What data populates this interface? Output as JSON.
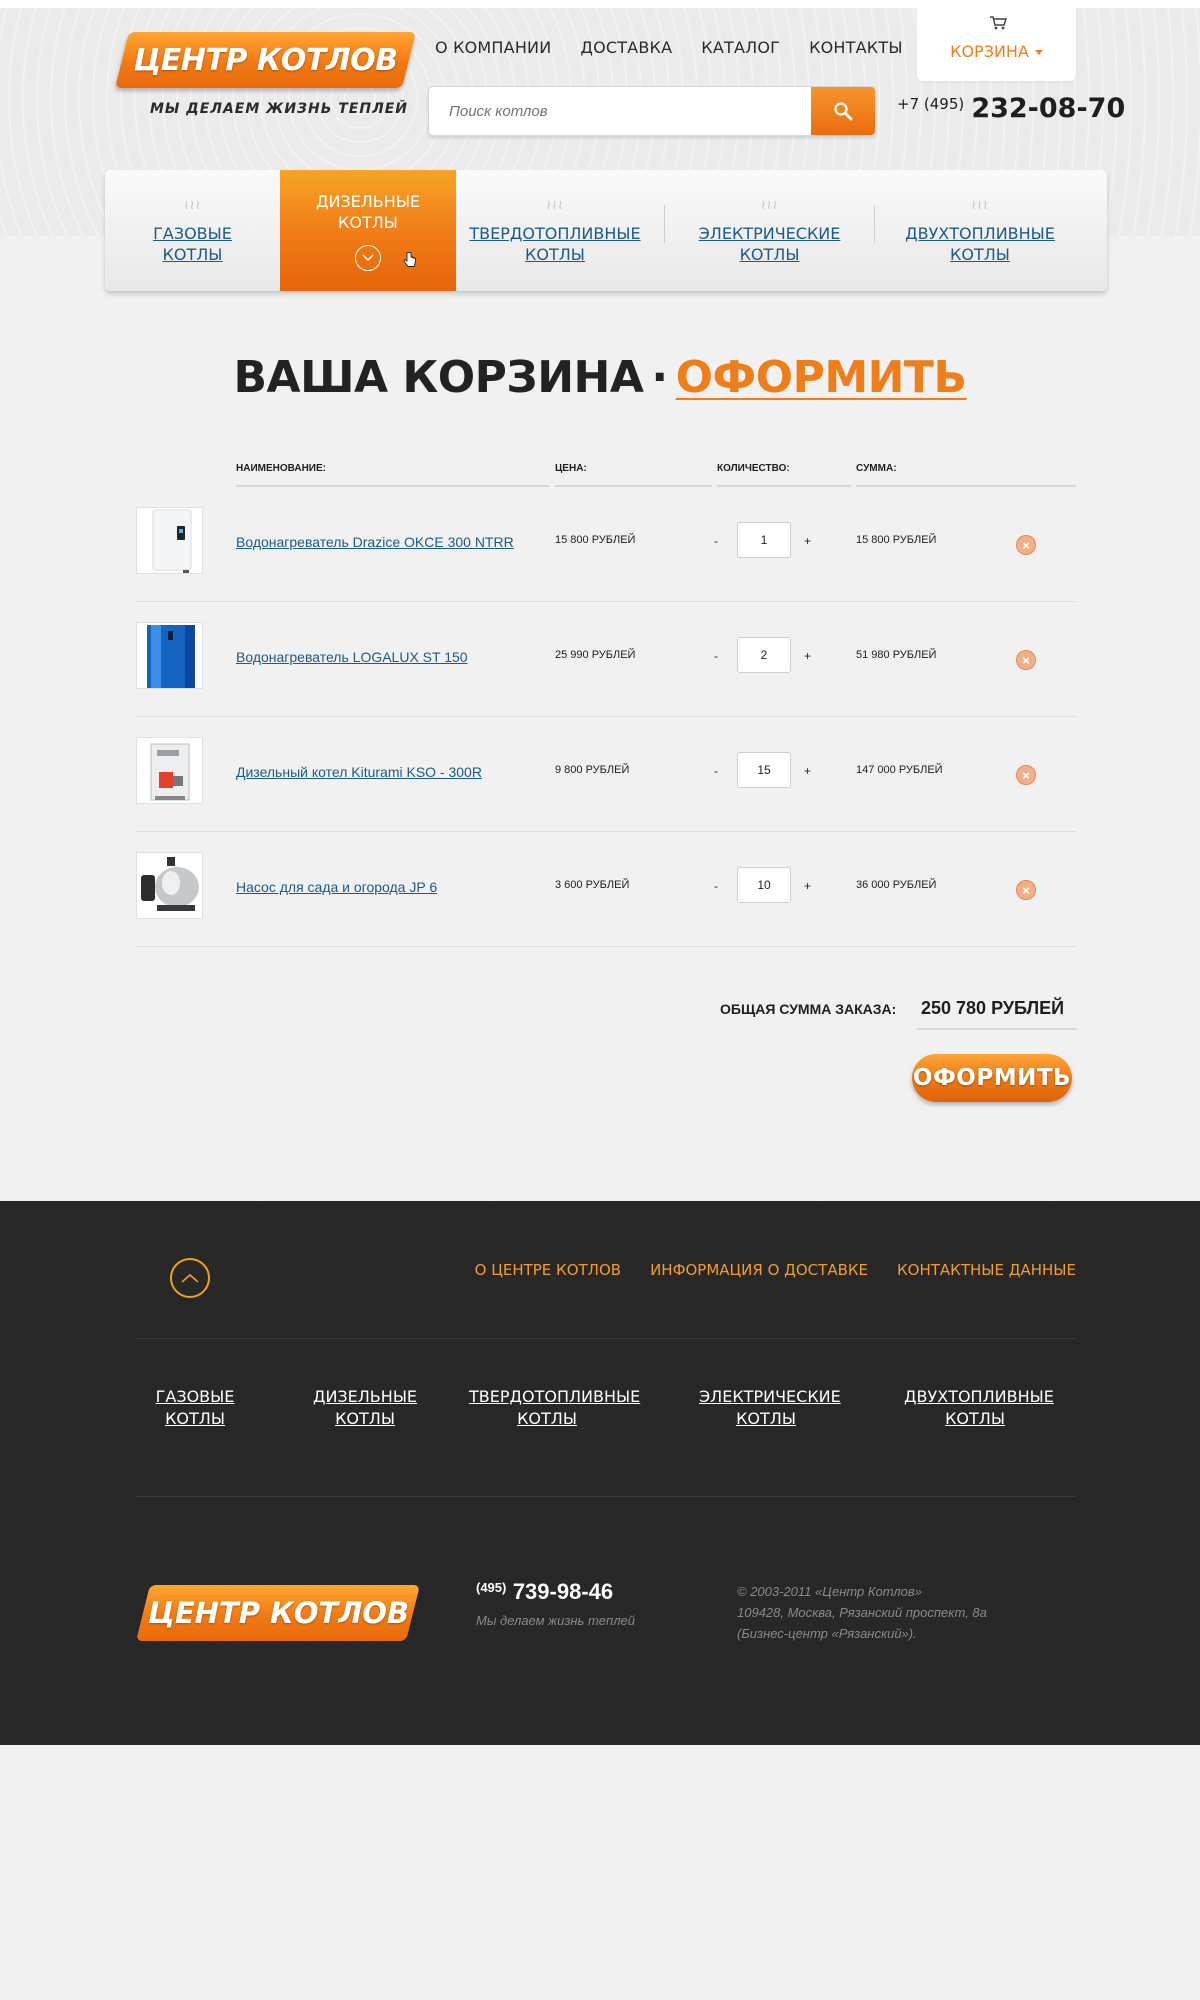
{
  "header": {
    "logo": "ЦЕНТР КОТЛОВ",
    "tagline": "МЫ ДЕЛАЕМ ЖИЗНЬ ТЕПЛЕЙ",
    "nav": [
      "О КОМПАНИИ",
      "ДОСТАВКА",
      "КАТАЛОГ",
      "КОНТАКТЫ"
    ],
    "cart_label": "КОРЗИНА",
    "search_placeholder": "Поиск котлов",
    "phone_code": "+7 (495)",
    "phone_number": "232-08-70"
  },
  "categories": [
    {
      "line1": "ГАЗОВЫЕ",
      "line2": "КОТЛЫ",
      "active": false
    },
    {
      "line1": "ДИЗЕЛЬНЫЕ",
      "line2": "КОТЛЫ",
      "active": true
    },
    {
      "line1": "ТВЕРДОТОПЛИВНЫЕ",
      "line2": "КОТЛЫ",
      "active": false
    },
    {
      "line1": "ЭЛЕКТРИЧЕСКИЕ",
      "line2": "КОТЛЫ",
      "active": false
    },
    {
      "line1": "ДВУХТОПЛИВНЫЕ",
      "line2": "КОТЛЫ",
      "active": false
    }
  ],
  "cart": {
    "title": "ВАША КОРЗИНА",
    "title_sep": "·",
    "title_action": "ОФОРМИТЬ",
    "columns": {
      "name": "НАИМЕНОВАНИЕ:",
      "price": "ЦЕНА:",
      "qty": "КОЛИЧЕСТВО:",
      "sum": "СУММА:"
    },
    "items": [
      {
        "name": "Водонагреватель Drazice OKCE 300 NTRR",
        "price": "15 800 РУБЛЕЙ",
        "qty": "1",
        "sum": "15 800 РУБЛЕЙ",
        "image": "white-water-heater"
      },
      {
        "name": "Водонагреватель LOGALUX ST 150",
        "price": "25 990 РУБЛЕЙ",
        "qty": "2",
        "sum": "51 980 РУБЛЕЙ",
        "image": "blue-water-tank"
      },
      {
        "name": "Дизельный котел Kiturami KSO - 300R",
        "price": "9 800 РУБЛЕЙ",
        "qty": "15",
        "sum": "147 000 РУБЛЕЙ",
        "image": "diesel-boiler"
      },
      {
        "name": "Насос для сада и огорода JP 6",
        "price": "3 600 РУБЛЕЙ",
        "qty": "10",
        "sum": "36 000 РУБЛЕЙ",
        "image": "garden-pump"
      }
    ],
    "minus": "-",
    "plus": "+",
    "remove_icon": "close-icon",
    "total_label": "ОБЩАЯ СУММА ЗАКАЗА:",
    "total_value": "250 780 РУБЛЕЙ",
    "order_button": "ОФОРМИТЬ"
  },
  "footer": {
    "nav": [
      "О ЦЕНТРЕ КОТЛОВ",
      "ИНФОРМАЦИЯ О ДОСТАВКЕ",
      "КОНТАКТНЫЕ ДАННЫЕ"
    ],
    "categories": [
      {
        "line1": "ГАЗОВЫЕ",
        "line2": "КОТЛЫ"
      },
      {
        "line1": "ДИЗЕЛЬНЫЕ",
        "line2": "КОТЛЫ"
      },
      {
        "line1": "ТВЕРДОТОПЛИВНЫЕ",
        "line2": "КОТЛЫ"
      },
      {
        "line1": "ЭЛЕКТРИЧЕСКИЕ",
        "line2": "КОТЛЫ"
      },
      {
        "line1": "ДВУХТОПЛИВНЫЕ",
        "line2": "КОТЛЫ"
      }
    ],
    "logo": "ЦЕНТР КОТЛОВ",
    "phone_code": "(495)",
    "phone_number": "739-98-46",
    "slogan": "Мы делаем жизнь теплей",
    "copyright": "© 2003-2011 «Центр Котлов»",
    "address1": "109428, Москва, Рязанский проспект, 8а",
    "address2": "(Бизнес-центр «Рязанский»)."
  },
  "colors": {
    "accent": "#ef7d19",
    "link": "#1c5a8a",
    "footer_bg": "#262626"
  }
}
